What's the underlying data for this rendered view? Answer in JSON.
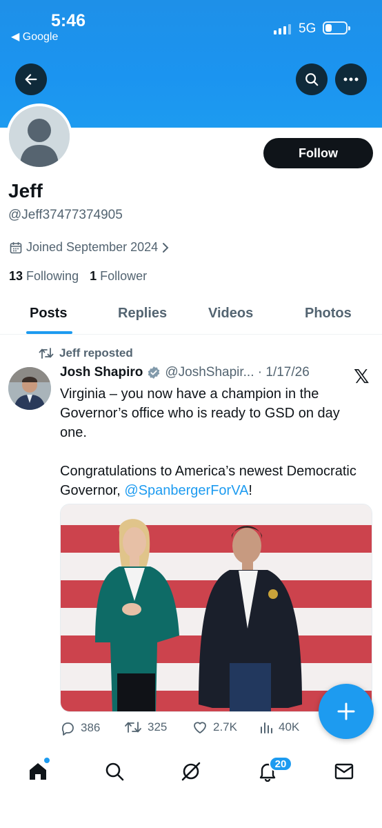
{
  "status_bar": {
    "time": "5:46",
    "back_app": "◀ Google",
    "network": "5G"
  },
  "colors": {
    "accent": "#1d9bf0",
    "text": "#0f1419",
    "muted": "#536471",
    "banner": "#1d9bf0"
  },
  "profile": {
    "name": "Jeff",
    "handle": "@Jeff37477374905",
    "joined": "Joined September 2024",
    "following_count": "13",
    "following_label": "Following",
    "followers_count": "1",
    "followers_label": "Follower",
    "follow_button": "Follow"
  },
  "tabs": [
    {
      "label": "Posts",
      "active": true
    },
    {
      "label": "Replies",
      "active": false
    },
    {
      "label": "Videos",
      "active": false
    },
    {
      "label": "Photos",
      "active": false
    }
  ],
  "tweet": {
    "repost_label": "Jeff reposted",
    "author_name": "Josh Shapiro",
    "author_handle_date": "@JoshShapir... · 1/17/26",
    "text_line1": "Virginia – you now have a champion in the Governor’s office who is ready to GSD on day one.",
    "text_line2": "Congratulations to America’s newest Democratic Governor,",
    "mention": "@SpanbergerForVA",
    "text_end": "!",
    "stats": {
      "replies": "386",
      "reposts": "325",
      "likes": "2.7K",
      "views": "40K"
    }
  },
  "bottom_nav": {
    "notifications_badge": "20"
  },
  "icons": [
    "back-arrow-icon",
    "search-icon",
    "more-icon",
    "calendar-icon",
    "chevron-right-icon",
    "repost-icon",
    "verified-icon",
    "x-logo-icon",
    "reply-icon",
    "like-icon",
    "views-icon",
    "plus-icon",
    "home-icon",
    "grok-icon",
    "bell-icon",
    "mail-icon"
  ]
}
